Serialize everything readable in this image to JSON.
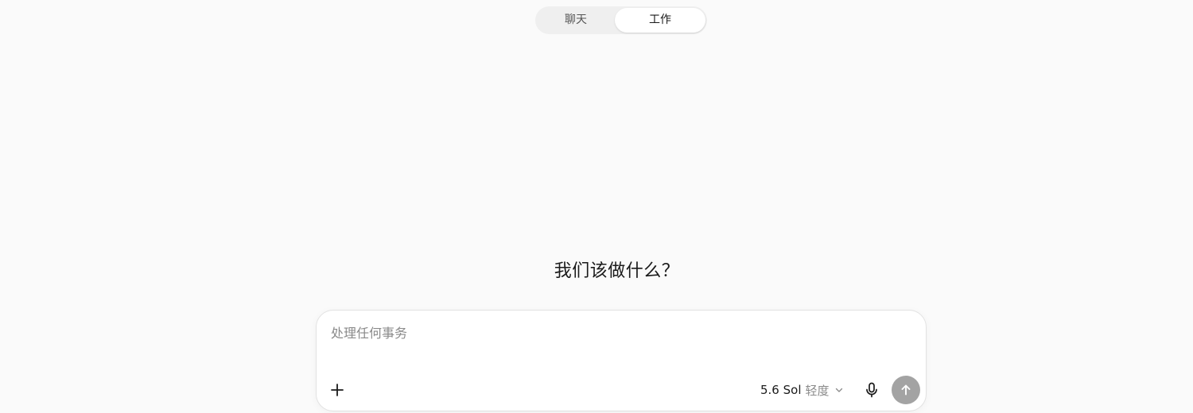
{
  "mode_toggle": {
    "tabs": [
      {
        "label": "聊天",
        "active": false
      },
      {
        "label": "工作",
        "active": true
      }
    ]
  },
  "headline": "我们该做什么？",
  "composer": {
    "placeholder": "处理任何事务",
    "value": "",
    "model": {
      "name": "5.6 Sol",
      "effort": "轻度"
    },
    "icons": {
      "attach": "plus-icon",
      "model_dropdown": "chevron-down-icon",
      "voice": "microphone-icon",
      "send": "arrow-up-icon"
    }
  },
  "colors": {
    "background": "#fafafa",
    "send_button": "#a3a3a3"
  }
}
